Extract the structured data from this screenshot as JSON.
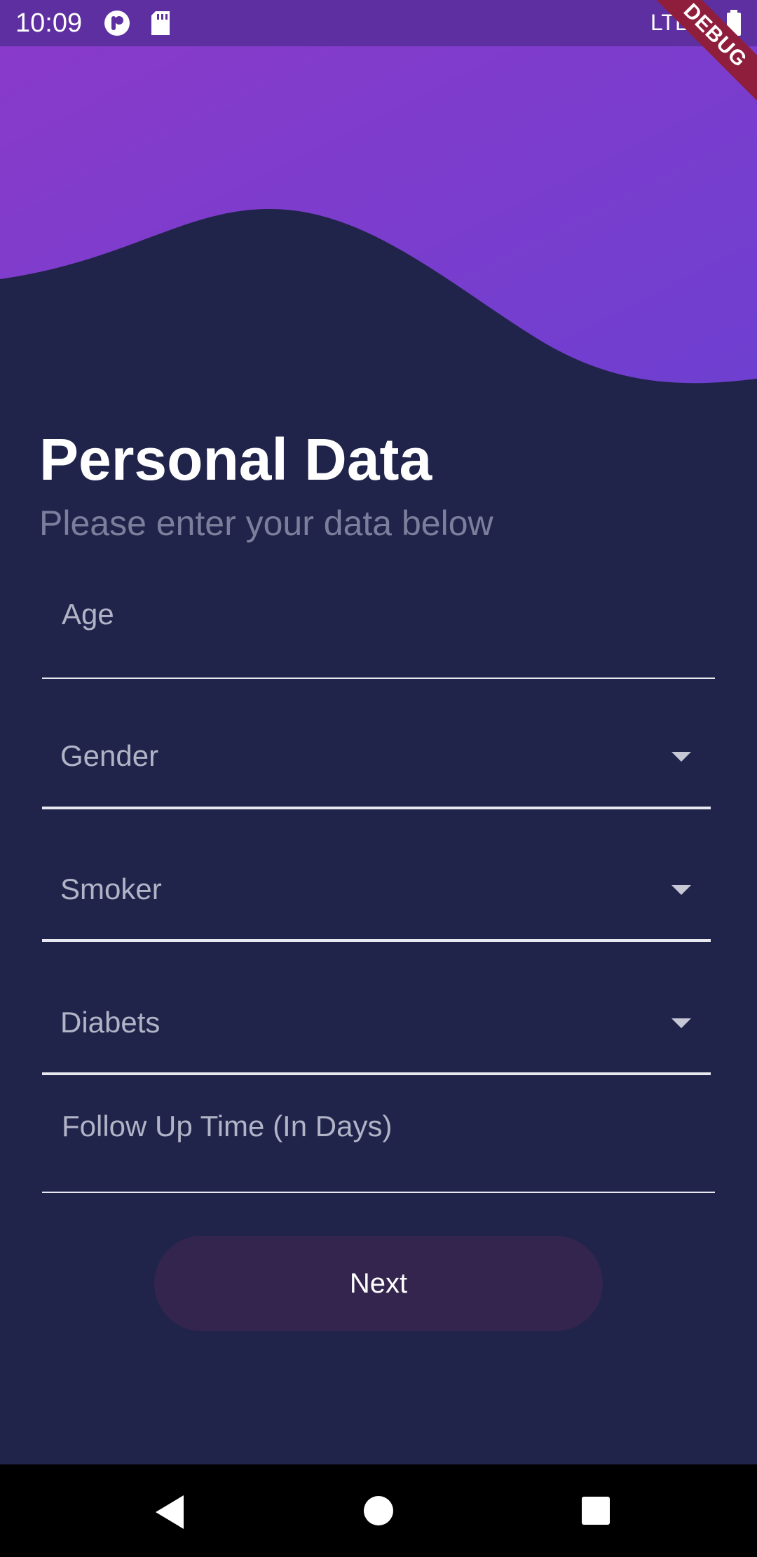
{
  "status_bar": {
    "time": "10:09",
    "network": "LTE"
  },
  "debug_banner": "DEBUG",
  "header": {
    "title": "Personal Data",
    "subtitle": "Please enter your data below"
  },
  "form": {
    "age_placeholder": "Age",
    "gender_label": "Gender",
    "smoker_label": "Smoker",
    "diabetes_label": "Diabets",
    "follow_up_placeholder": "Follow Up Time (In Days)",
    "next_label": "Next"
  },
  "colors": {
    "background": "#21244a",
    "header_gradient_start": "#8b3ac9",
    "header_gradient_end": "#6f3dd0",
    "button": "#34254e",
    "subtitle": "#7c7f9c"
  }
}
